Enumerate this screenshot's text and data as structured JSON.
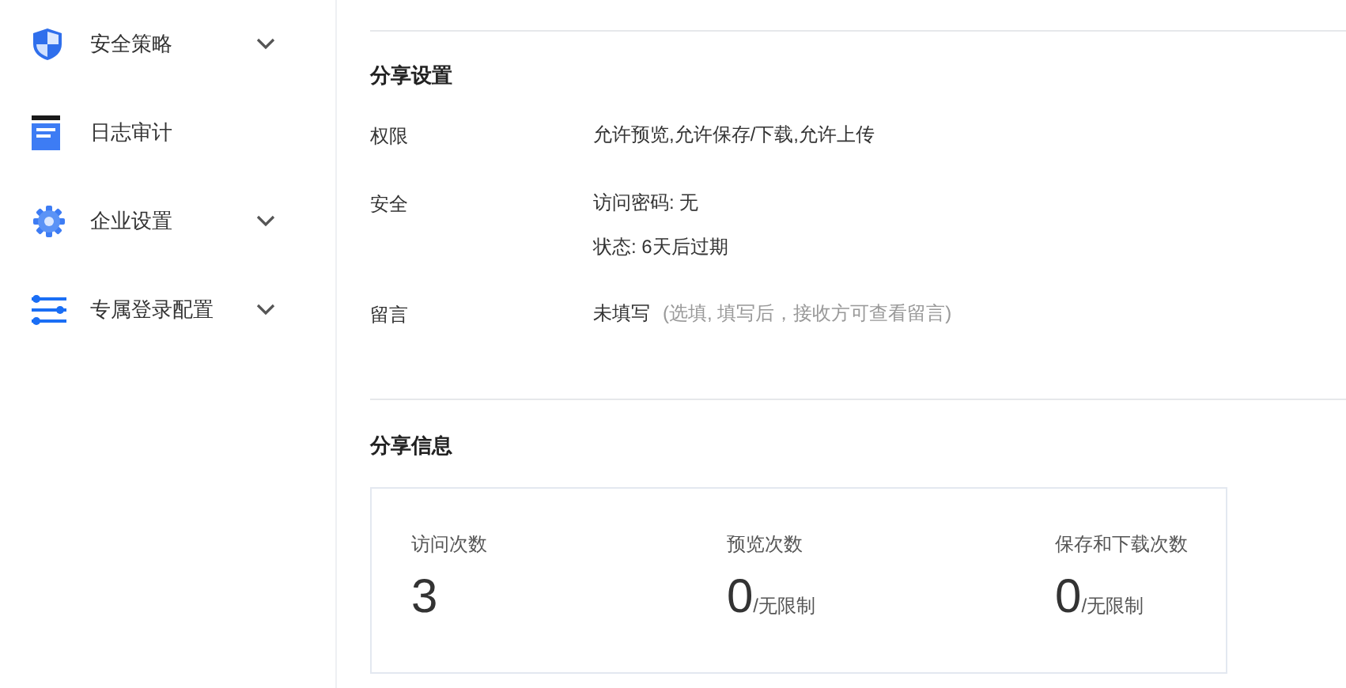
{
  "sidebar": {
    "items": [
      {
        "kind": "shield",
        "label": "安全策略",
        "expandable": true
      },
      {
        "kind": "log",
        "label": "日志审计",
        "expandable": false
      },
      {
        "kind": "gear",
        "label": "企业设置",
        "expandable": true
      },
      {
        "kind": "sliders",
        "label": "专属登录配置",
        "expandable": true
      }
    ]
  },
  "share_settings": {
    "title": "分享设置",
    "rows": [
      {
        "label": "权限",
        "lines": [
          "允许预览,允许保存/下载,允许上传"
        ]
      },
      {
        "label": "安全",
        "lines": [
          "访问密码: 无",
          "状态: 6天后过期"
        ]
      },
      {
        "label": "留言",
        "lines": [
          "未填写"
        ],
        "hint": "(选填, 填写后，接收方可查看留言)"
      }
    ]
  },
  "share_info": {
    "title": "分享信息",
    "stats": [
      {
        "label": "访问次数",
        "value": "3"
      },
      {
        "label": "预览次数",
        "value": "0",
        "suffix": "/无限制"
      },
      {
        "label": "保存和下载次数",
        "value": "0",
        "suffix": "/无限制"
      }
    ]
  }
}
